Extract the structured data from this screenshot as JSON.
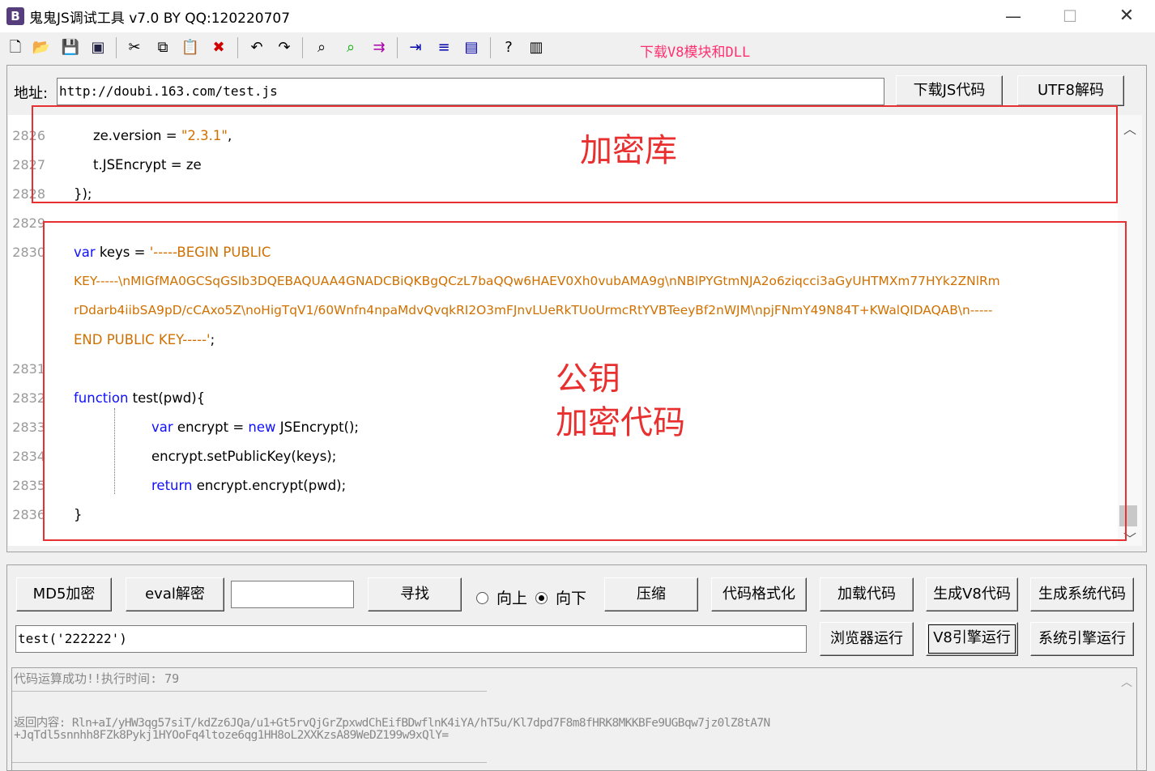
{
  "window": {
    "title": "鬼鬼JS调试工具 v7.0 BY QQ:120220707",
    "app_icon": "B"
  },
  "toolbar": {
    "download_link": "下载V8模块和DLL",
    "icons": [
      "new-file-icon",
      "open-folder-icon",
      "save-icon",
      "save-all-icon",
      "cut-icon",
      "copy-icon",
      "paste-icon",
      "delete-icon",
      "undo-icon",
      "redo-icon",
      "find-icon",
      "find-next-icon",
      "replace-icon",
      "indent-icon",
      "numbering-icon",
      "format-icon",
      "help-icon",
      "panel-icon"
    ]
  },
  "address": {
    "label": "地址:",
    "value": "http://doubi.163.com/test.js",
    "download_js_button": "下载JS代码",
    "utf8_button": "UTF8解码"
  },
  "editor": {
    "lines": [
      {
        "num": "2826",
        "text": "ze.version = \"2.3.1\","
      },
      {
        "num": "2827",
        "text": "t.JSEncrypt = ze"
      },
      {
        "num": "2828",
        "text": "});"
      },
      {
        "num": "2829",
        "text": ""
      },
      {
        "num": "2830",
        "text": "var keys = '-----BEGIN PUBLIC"
      },
      {
        "num": "2830b",
        "text": "KEY-----\\nMIGfMA0GCSqGSIb3DQEBAQUAA4GNADCBiQKBgQCzL7baQQw6HAEV0Xh0vubAMA9g\\nNBlPYGtmNJA2o6ziqcci3aGyUHTMXm77HYk2ZNlRm"
      },
      {
        "num": "2830c",
        "text": "rDdarb4iibSA9pD/cCAxo5Z\\noHigTqV1/60Wnfn4npaMdvQvqkRI2O3mFJnvLUeRkTUoUrmcRtYVBTeeyBf2nWJM\\npjFNmY49N84T+KWalQIDAQAB\\n-----"
      },
      {
        "num": "2830d",
        "text": "END PUBLIC KEY-----';"
      },
      {
        "num": "2831",
        "text": ""
      },
      {
        "num": "2832",
        "text": "function test(pwd){"
      },
      {
        "num": "2833",
        "text": "var encrypt = new JSEncrypt();"
      },
      {
        "num": "2834",
        "text": "encrypt.setPublicKey(keys);"
      },
      {
        "num": "2835",
        "text": "return encrypt.encrypt(pwd);"
      },
      {
        "num": "2836",
        "text": "}"
      }
    ],
    "tokens": {
      "ze_version": "ze.version = ",
      "version_str": "\"2.3.1\"",
      "comma": ",",
      "jsencrypt_line": "t.JSEncrypt = ze",
      "close": "});",
      "var_kw": "var",
      "keys_assign": " keys = ",
      "key_start": "'-----BEGIN PUBLIC",
      "key_line2": "KEY-----\\nMIGfMA0GCSqGSIb3DQEBAQUAA4GNADCBiQKBgQCzL7baQQw6HAEV0Xh0vubAMA9g\\nNBlPYGtmNJA2o6ziqcci3aGyUHTMXm77HYk2ZNlRm",
      "key_line3": "rDdarb4iibSA9pD/cCAxo5Z\\noHigTqV1/60Wnfn4npaMdvQvqkRI2O3mFJnvLUeRkTUoUrmcRtYVBTeeyBf2nWJM\\npjFNmY49N84T+KWalQIDAQAB\\n-----",
      "key_end": "END PUBLIC KEY-----'",
      "semicolon": ";",
      "function_kw": "function",
      "test_sig": " test(pwd){",
      "encrypt_var": " encrypt = ",
      "new_kw": "new",
      "jsencrypt_call": " JSEncrypt();",
      "setkey": "encrypt.setPublicKey(keys);",
      "return_kw": "return",
      "encrypt_call": " encrypt.encrypt(pwd);",
      "brace": "}"
    }
  },
  "annotations": {
    "box1_label": "加密库",
    "box2_label_line1": "公钥",
    "box2_label_line2": "加密代码",
    "color": "#e83030"
  },
  "bottom": {
    "md5_button": "MD5加密",
    "eval_button": "eval解密",
    "search_value": "",
    "find_button": "寻找",
    "radio_up": "向上",
    "radio_down": "向下",
    "radio_selected": "向下",
    "compress_button": "压缩",
    "format_button": "代码格式化",
    "load_button": "加载代码",
    "gen_v8_button": "生成V8代码",
    "gen_sys_button": "生成系统代码",
    "command_value": "test('222222')",
    "browser_run_button": "浏览器运行",
    "v8_run_button": "V8引擎运行",
    "sys_run_button": "系统引擎运行"
  },
  "output": {
    "status_line": "代码运算成功!!执行时间: 79",
    "result_label": "返回内容:",
    "result_line1": "Rln+aI/yHW3qg57siT/kdZz6JQa/u1+Gt5rvQjGrZpxwdChEifBDwflnK4iYA/hT5u/Kl7dpd7F8m8fHRK8MKKBFe9UGBqw7jz0lZ8tA7N",
    "result_line2": "+JqTdl5snnhh8FZk8Pykj1HYOoFq4ltoze6qg1HH8oL2XXKzsA89WeDZ199w9xQlY="
  }
}
